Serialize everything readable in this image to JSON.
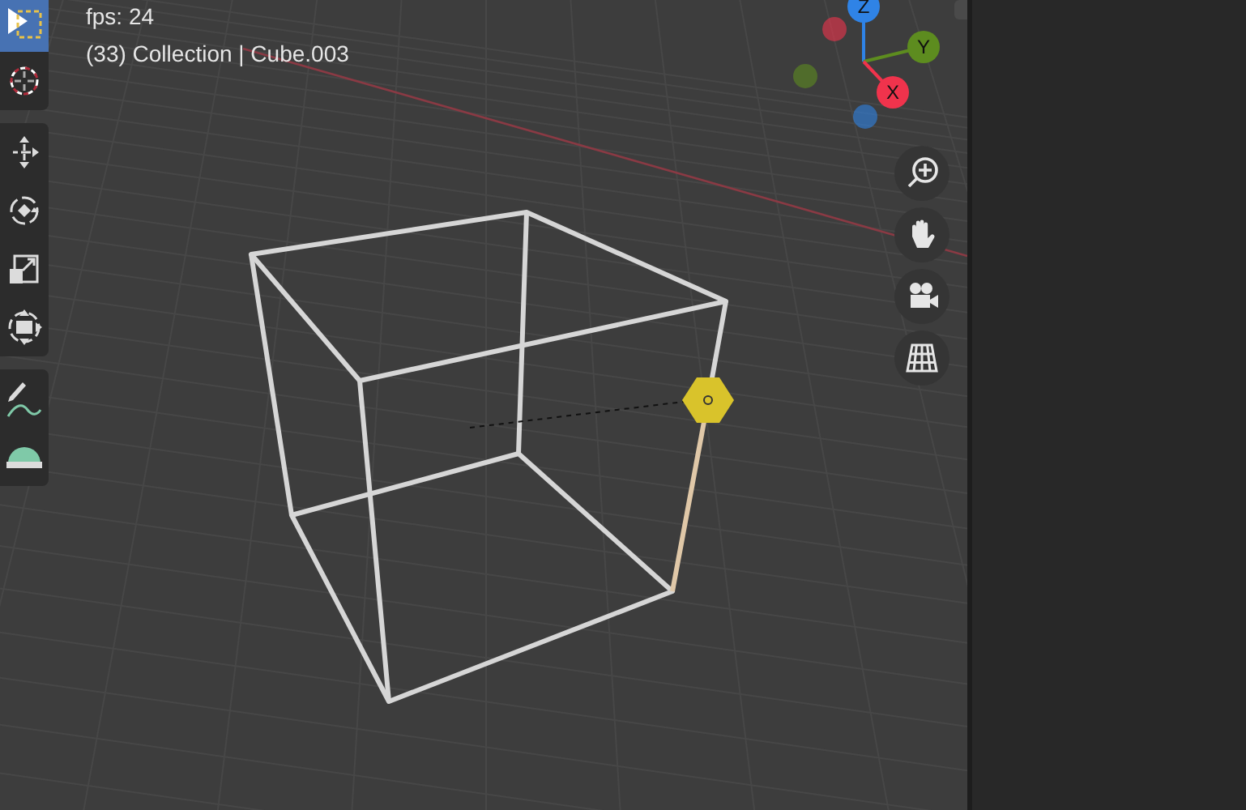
{
  "viewport": {
    "info_lines": [
      "fps: 24",
      "(33) Collection | Cube.003"
    ],
    "toolbar": [
      [
        {
          "kind": "select",
          "selected": true
        },
        {
          "kind": "cursor",
          "selected": false
        }
      ],
      [
        {
          "kind": "move",
          "selected": false
        },
        {
          "kind": "rotate",
          "selected": false
        },
        {
          "kind": "scale",
          "selected": false
        },
        {
          "kind": "transform",
          "selected": false
        }
      ],
      [
        {
          "kind": "annotate",
          "selected": false
        },
        {
          "kind": "measure",
          "selected": false
        }
      ]
    ],
    "gizmo": [
      {
        "label": "Z",
        "color": "#2f83e6"
      },
      {
        "label": "Y",
        "color": "#5d8c1f"
      },
      {
        "label": "X",
        "color": "#f0334c"
      }
    ],
    "nav_buttons": [
      {
        "kind": "zoom"
      },
      {
        "kind": "pan"
      },
      {
        "kind": "camera"
      },
      {
        "kind": "ortho"
      }
    ]
  }
}
